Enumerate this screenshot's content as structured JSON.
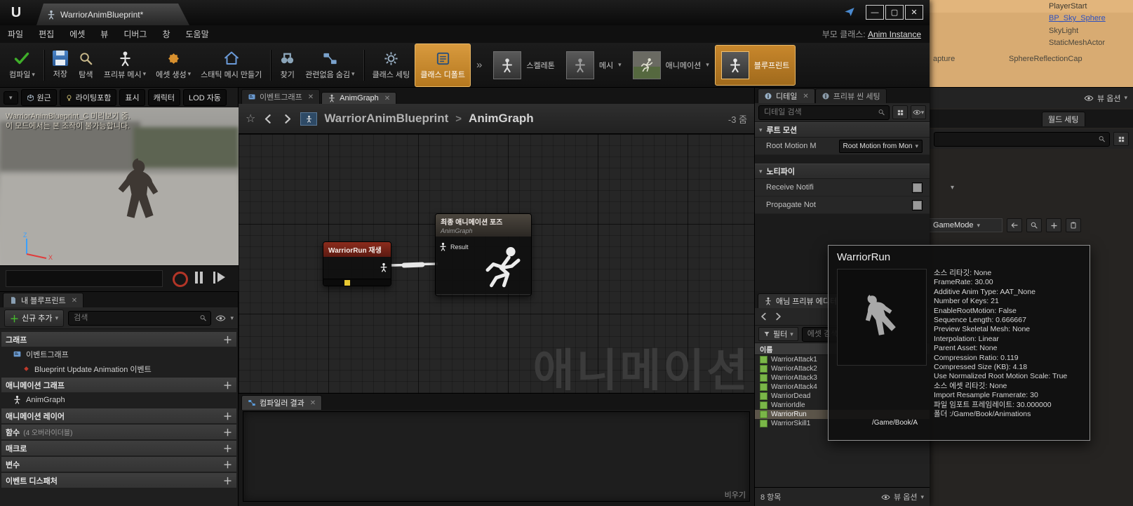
{
  "colors": {
    "accent-orange": "#c8872c",
    "node-header-red": "#5c1a12",
    "anim-asset-green": "#7ab648",
    "selection-row": "#5c554a",
    "outliner-tan": "#d8ab72",
    "outliner-link-blue": "#2d50c0"
  },
  "titlebar": {
    "tab_title": "WarriorAnimBlueprint*"
  },
  "menubar": {
    "items": [
      "파일",
      "편집",
      "에셋",
      "뷰",
      "디버그",
      "창",
      "도움말"
    ],
    "parent_class_label": "부모 클래스:",
    "parent_class_value": "Anim Instance"
  },
  "toolbar": {
    "compile": "컴파일",
    "save": "저장",
    "browse": "탐색",
    "preview_mesh": "프리뷰 메시",
    "create_asset": "에셋 생성",
    "make_static_mesh": "스태틱 메시 만들기",
    "find": "찾기",
    "hide_unrelated": "관련없음 숨김",
    "class_settings": "클래스 세팅",
    "class_defaults": "클래스 디폴트",
    "skeleton": "스켈레톤",
    "mesh": "메시",
    "animation": "애니메이션",
    "blueprint": "블루프린트"
  },
  "viewport": {
    "buttons": {
      "perspective": "원근",
      "lit": "라이팅포함",
      "show": "표시",
      "character": "캐릭터",
      "lod": "LOD 자동"
    },
    "warning_line1": "WarriorAnimBlueprint_C 미리보기 중.",
    "warning_line2": "이 모드에서는 본 조작이 불가능합니다.",
    "axis_z": "Z",
    "axis_x": "X"
  },
  "my_blueprint": {
    "tab": "내 블루프린트",
    "add_new": "신규 추가",
    "search_placeholder": "검색",
    "sections": {
      "graphs": "그래프",
      "event_graph": "이벤트그래프",
      "bp_update_event": "Blueprint Update Animation 이벤트",
      "anim_graphs": "애니메이션 그래프",
      "animgraph": "AnimGraph",
      "anim_layers": "애니메이션 레이어",
      "functions": "함수",
      "functions_note": "(4 오버라이더블)",
      "macros": "매크로",
      "variables": "변수",
      "event_dispatchers": "이벤트 디스패처"
    }
  },
  "graph": {
    "tab_event": "이벤트그래프",
    "tab_anim": "AnimGraph",
    "breadcrumb_root": "WarriorAnimBlueprint",
    "breadcrumb_sep": ">",
    "breadcrumb_current": "AnimGraph",
    "zoom": "-3 줌",
    "watermark": "애니메이션",
    "node_play": {
      "title": "WarriorRun 재생"
    },
    "node_output": {
      "title": "최종 애니메이션 포즈",
      "subtitle": "AnimGraph",
      "pin": "Result"
    }
  },
  "compiler": {
    "tab": "컴파일러 결과",
    "clear": "비우기"
  },
  "details": {
    "tab": "디테일",
    "tab2": "프리뷰 씬 세팅",
    "search_placeholder": "디테일 검색",
    "root_motion_section": "루트 모션",
    "root_motion_label": "Root Motion M",
    "root_motion_value": "Root Motion from Mon",
    "notify_section": "노티파이",
    "receive_label": "Receive Notifi",
    "propagate_label": "Propagate Not"
  },
  "anim_preview": {
    "tab": "애님 프리뷰 에디터",
    "filter": "필터",
    "search_placeholder": "에셋 검색",
    "column_name": "이름",
    "rows": [
      {
        "name": "WarriorAttack1",
        "selected": false
      },
      {
        "name": "WarriorAttack2",
        "selected": false
      },
      {
        "name": "WarriorAttack3",
        "selected": false
      },
      {
        "name": "WarriorAttack4",
        "selected": false
      },
      {
        "name": "WarriorDead",
        "selected": false
      },
      {
        "name": "WarriorIdle",
        "selected": false
      },
      {
        "name": "WarriorRun",
        "selected": true
      },
      {
        "name": "WarriorSkill1",
        "selected": false
      }
    ],
    "path_fragment": "/Game/Book/A",
    "count": "8 항목",
    "view_options": "뷰 옵션"
  },
  "tooltip": {
    "title": "WarriorRun",
    "lines": [
      "소스 리타깃: None",
      "FrameRate: 30.00",
      "Additive Anim Type: AAT_None",
      "Number of Keys: 21",
      "EnableRootMotion: False",
      "Sequence Length: 0.666667",
      "Preview Skeletal Mesh: None",
      "Interpolation: Linear",
      "Parent Asset: None",
      "Compression Ratio: 0.119",
      "Compressed Size (KB): 4.18",
      "Use Normalized Root Motion Scale: True",
      "소스 에셋 리타깃: None",
      "Import Resample Framerate: 30",
      "파일 임포트 프레임레이트: 30.000000",
      "폴더 :/Game/Book/Animations"
    ]
  },
  "background_window": {
    "outliner_rows": [
      "PlayerStart",
      "BP_Sky_Sphere",
      "SkyLight",
      "StaticMeshActor"
    ],
    "row_fragment_left": "apture",
    "row_fragment_right": "SphereReflectionCap",
    "view_options": "뷰 옵션",
    "world_settings": "월드 세팅",
    "gamemode_value": "GameMode"
  }
}
